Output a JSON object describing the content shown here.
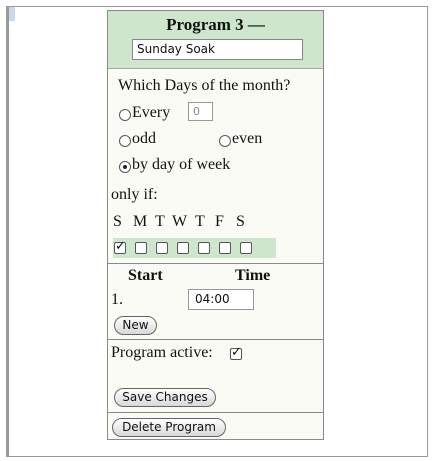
{
  "program": {
    "title": "Program 3 —",
    "name_value": "Sunday Soak"
  },
  "days": {
    "question": "Which Days of the month?",
    "every_label": "Every",
    "every_value": "0",
    "odd_label": "odd",
    "even_label": "even",
    "by_week_label": "by day of week",
    "selected": "by day of week",
    "only_if_label": "only if:",
    "weekdays": [
      "S",
      "M",
      "T",
      "W",
      "T",
      "F",
      "S"
    ],
    "weekday_checked": [
      true,
      false,
      false,
      false,
      false,
      false,
      false
    ]
  },
  "times": {
    "start_header": "Start",
    "time_header": "Time",
    "row_number": "1.",
    "row_value": "04:00",
    "new_label": "New"
  },
  "active": {
    "label": "Program active:",
    "checked": true,
    "save_label": "Save Changes"
  },
  "delete_label": "Delete Program",
  "colors": {
    "header_bg": "#cde6cc",
    "panel_bg": "#fbfbf6"
  }
}
